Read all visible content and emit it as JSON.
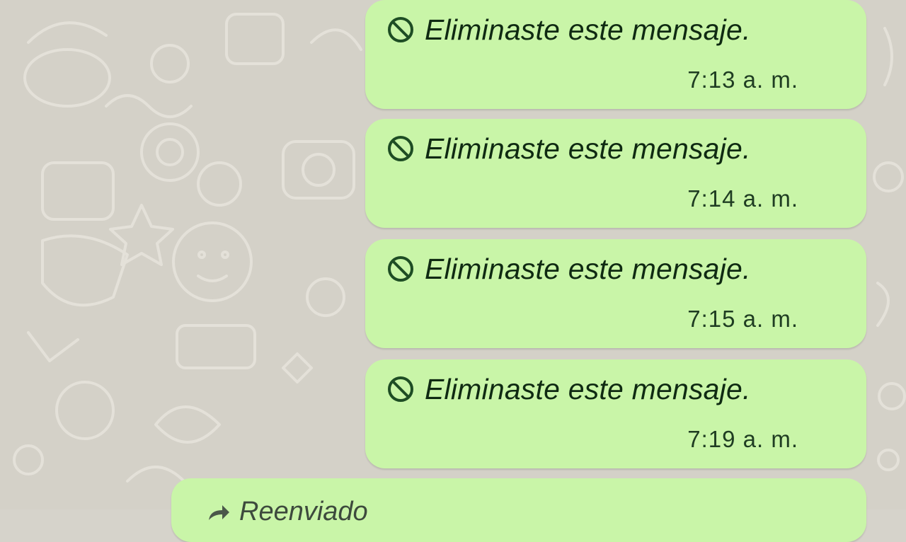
{
  "chat": {
    "messages": [
      {
        "icon": "blocked-icon",
        "text": "Eliminaste este mensaje.",
        "time": "7:13 a. m."
      },
      {
        "icon": "blocked-icon",
        "text": "Eliminaste este mensaje.",
        "time": "7:14 a. m."
      },
      {
        "icon": "blocked-icon",
        "text": "Eliminaste este mensaje.",
        "time": "7:15 a. m."
      },
      {
        "icon": "blocked-icon",
        "text": "Eliminaste este mensaje.",
        "time": "7:19 a. m."
      }
    ],
    "partial_message": {
      "icon": "forward-arrow-icon",
      "label": "Reenviado"
    }
  },
  "colors": {
    "bubble": "#c9f5a8",
    "wallpaper": "#d4d1c8",
    "icon": "#1e4d24"
  }
}
